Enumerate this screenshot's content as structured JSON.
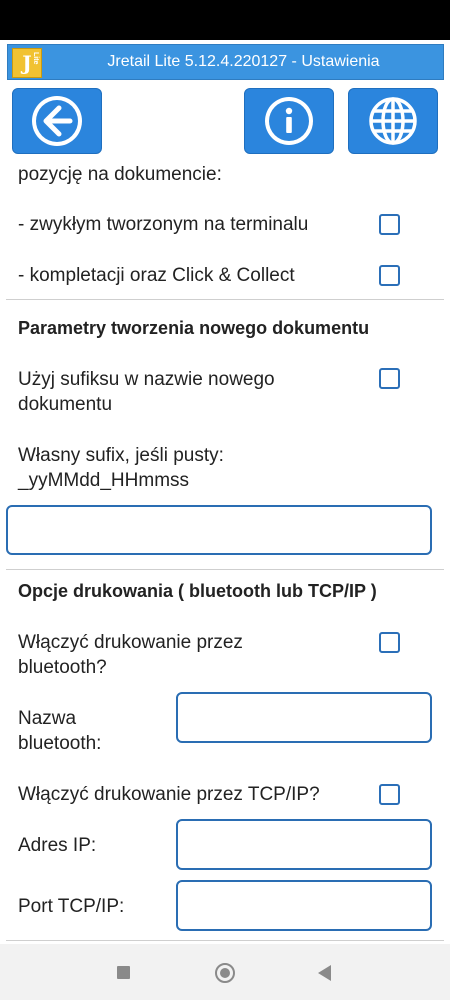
{
  "app": {
    "title": "Jretail Lite 5.12.4.220127 - Ustawienia",
    "logo_letter": "J",
    "logo_sub": "Lite"
  },
  "toolbar": {
    "back_icon": "arrow-left-icon",
    "info_icon": "info-icon",
    "language_icon": "globe-icon"
  },
  "sections": {
    "position": {
      "intro": "pozycję na dokumencie:",
      "terminal_label": "- zwykłym tworzonym na terminalu",
      "terminal_checked": false,
      "click_collect_label": "- kompletacji oraz Click & Collect",
      "click_collect_checked": false
    },
    "new_document": {
      "heading": "Parametry tworzenia nowego dokumentu",
      "suffix_label_1": "Użyj sufiksu w nazwie nowego",
      "suffix_label_2": "dokumentu",
      "suffix_checked": false,
      "custom_suffix_label_1": "Własny sufix, jeśli pusty:",
      "custom_suffix_label_2": "_yyMMdd_HHmmss",
      "custom_suffix_value": ""
    },
    "printing": {
      "heading": "Opcje drukowania ( bluetooth lub TCP/IP )",
      "bt_label_1": "Włączyć drukowanie przez",
      "bt_label_2": "bluetooth?",
      "bt_checked": false,
      "bt_name_label_1": "Nazwa",
      "bt_name_label_2": "bluetooth:",
      "bt_name_value": "",
      "tcp_label": "Włączyć drukowanie przez TCP/IP?",
      "tcp_checked": false,
      "ip_label": "Adres IP:",
      "ip_value": "",
      "port_label": "Port TCP/IP:",
      "port_value": ""
    }
  },
  "colors": {
    "accent": "#2b85dd",
    "app_bar": "#3b94e0",
    "checkbox_border": "#2b6fb8"
  }
}
